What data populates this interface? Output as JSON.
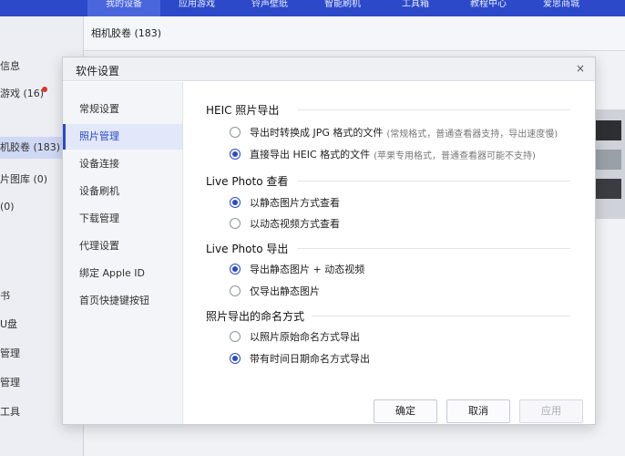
{
  "top_nav": {
    "tabs": [
      "我的设备",
      "应用游戏",
      "铃声壁纸",
      "智能刷机",
      "工具箱",
      "教程中心",
      "爱思商城"
    ]
  },
  "sub_tab": "相机胶卷 (183)",
  "sidebar": {
    "items": [
      "信息",
      "游戏  (16)",
      "机胶卷 (183)",
      "片图库 (0)",
      "(0)",
      "书",
      "U盘",
      "管理",
      "管理",
      "工具"
    ]
  },
  "dialog": {
    "title": "软件设置",
    "close": "×",
    "nav": [
      "常规设置",
      "照片管理",
      "设备连接",
      "设备刷机",
      "下载管理",
      "代理设置",
      "绑定 Apple ID",
      "首页快捷键按钮"
    ],
    "active_nav": 1,
    "sections": [
      {
        "title": "HEIC 照片导出",
        "options": [
          {
            "label": "导出时转换成 JPG 格式的文件",
            "note": "(常规格式，普通查看器支持，导出速度慢)",
            "selected": false
          },
          {
            "label": "直接导出 HEIC 格式的文件",
            "note": "(苹果专用格式，普通查看器可能不支持)",
            "selected": true
          }
        ]
      },
      {
        "title": "Live Photo 查看",
        "options": [
          {
            "label": "以静态图片方式查看",
            "note": "",
            "selected": true
          },
          {
            "label": "以动态视频方式查看",
            "note": "",
            "selected": false
          }
        ]
      },
      {
        "title": "Live Photo 导出",
        "options": [
          {
            "label": "导出静态图片 + 动态视频",
            "note": "",
            "selected": true
          },
          {
            "label": "仅导出静态图片",
            "note": "",
            "selected": false
          }
        ]
      },
      {
        "title": "照片导出的命名方式",
        "options": [
          {
            "label": "以照片原始命名方式导出",
            "note": "",
            "selected": false
          },
          {
            "label": "带有时间日期命名方式导出",
            "note": "",
            "selected": true
          }
        ]
      }
    ],
    "buttons": {
      "ok": "确定",
      "cancel": "取消",
      "apply": "应用"
    }
  },
  "colors": {
    "accent": "#2b49c9",
    "badge": "#e0302a"
  }
}
